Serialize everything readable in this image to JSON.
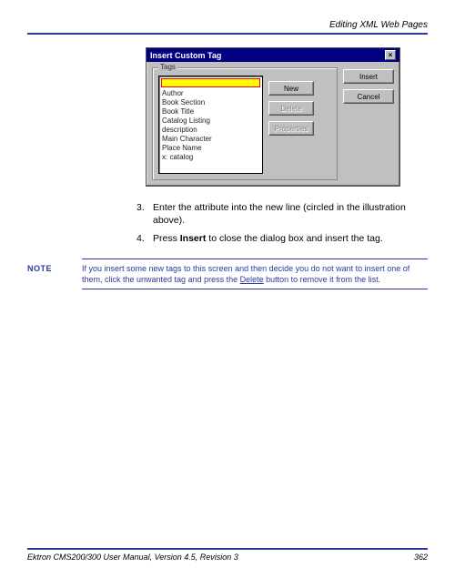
{
  "header": {
    "section_title": "Editing XML Web Pages"
  },
  "dialog": {
    "title": "Insert Custom Tag",
    "group_label": "Tags",
    "list_items": [
      "Author",
      "Book Section",
      "Book Title",
      "Catalog Listing",
      "description",
      "Main Character",
      "Place Name",
      "x: catalog"
    ],
    "buttons": {
      "new": "New",
      "delete": "Delete",
      "properties": "Properties",
      "insert": "Insert",
      "cancel": "Cancel"
    }
  },
  "instructions": {
    "items": [
      {
        "num": "3.",
        "text_before": "Enter the attribute into the new line (circled in the illustration above).",
        "bold": "",
        "text_after": ""
      },
      {
        "num": "4.",
        "text_before": "Press ",
        "bold": "Insert",
        "text_after": " to close the dialog box and insert the tag."
      }
    ]
  },
  "note": {
    "label": "NOTE",
    "pre": "If you insert some new tags to this screen and then decide you do not want to insert one of them, click the unwanted tag and press the ",
    "underline": "Delete",
    "post": " button to remove it from the list."
  },
  "footer": {
    "left": "Ektron CMS200/300 User Manual, Version 4.5, Revision 3",
    "right": "362"
  }
}
